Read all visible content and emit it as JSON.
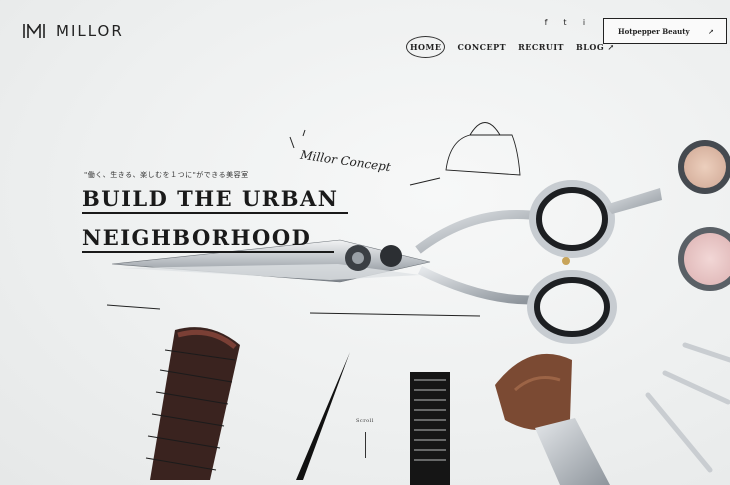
{
  "brand": {
    "name": "MILLOR"
  },
  "social": [
    "f",
    "t",
    "i"
  ],
  "social_icons": [
    "facebook-icon",
    "twitter-icon",
    "instagram-icon"
  ],
  "nav": [
    {
      "label": "HOME",
      "active": true
    },
    {
      "label": "CONCEPT"
    },
    {
      "label": "RECRUIT"
    },
    {
      "label": "BLOG ↗"
    }
  ],
  "hotpepper": {
    "label": "Hotpepper Beauty",
    "icon": "↗"
  },
  "hero": {
    "tagline": "\"働く、生きる、楽しむを１つに\"ができる美容室",
    "line1": "BUILD THE URBAN",
    "line2": "NEIGHBORHOOD",
    "concept": "Millor Concept"
  },
  "scroll": {
    "label": "Scroll"
  },
  "colors": {
    "text": "#1a1a1a",
    "background": "#f1f2f2",
    "steel": "#c9cdd1"
  }
}
